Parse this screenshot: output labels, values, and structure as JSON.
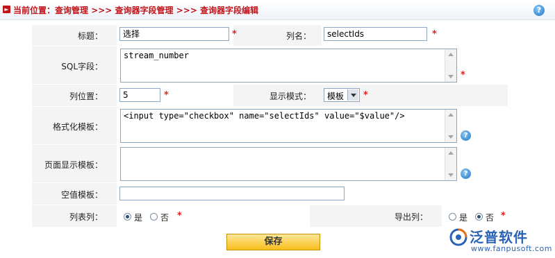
{
  "breadcrumb": {
    "prefix": "当前位置：",
    "path": "查询管理 >>> 查询器字段管理 >>> 查询器字段编辑"
  },
  "help_symbol": "?",
  "required_mark": "*",
  "form": {
    "title": {
      "label": "标题：",
      "value": "选择"
    },
    "column_name": {
      "label": "列名：",
      "value": "selectIds"
    },
    "sql_field": {
      "label": "SQL字段：",
      "value": "stream_number"
    },
    "column_position": {
      "label": "列位置：",
      "value": "5"
    },
    "display_mode": {
      "label": "显示模式：",
      "value": "模板"
    },
    "format_template": {
      "label": "格式化模板：",
      "value": "<input type=\"checkbox\" name=\"selectIds\" value=\"$value\"/>"
    },
    "page_display_template": {
      "label": "页面显示模板：",
      "value": ""
    },
    "empty_value_template": {
      "label": "空值模板：",
      "value": ""
    },
    "list_column": {
      "label": "列表列：",
      "options": [
        "是",
        "否"
      ],
      "selected": "是"
    },
    "export_column": {
      "label": "导出列：",
      "options": [
        "是",
        "否"
      ],
      "selected": "否"
    }
  },
  "save_label": "保存",
  "logo": {
    "name": "泛普软件",
    "url": "www.fanpusoft.com"
  },
  "colors": {
    "accent_red": "#c0141a",
    "brand_blue": "#2a62b5",
    "button_yellow": "#f7be1a"
  }
}
